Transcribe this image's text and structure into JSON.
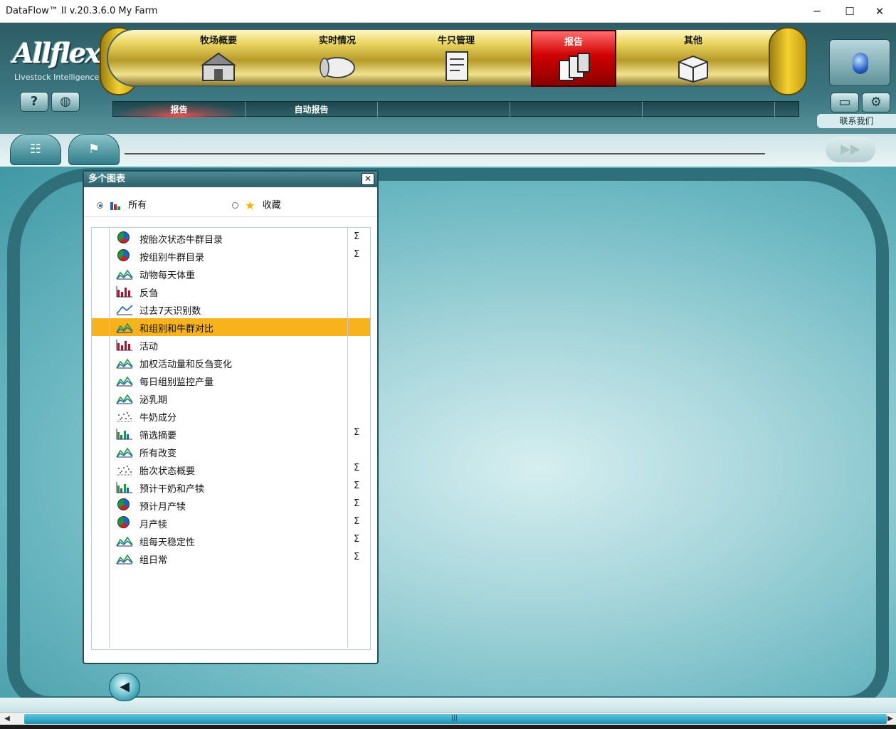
{
  "window": {
    "title": "DataFlow™ II v.20.3.6.0 My Farm",
    "controls": [
      "─",
      "☐",
      "✕"
    ]
  },
  "brand": {
    "logo": "Allflex",
    "tagline": "Livestock Intelligence"
  },
  "header_buttons": {
    "help": "?",
    "globe": "◍"
  },
  "nav": {
    "items": [
      {
        "label": "牧场概要",
        "icon": "barn-icon"
      },
      {
        "label": "实时情况",
        "icon": "milk-tank-icon"
      },
      {
        "label": "牛只管理",
        "icon": "clipboard-icon"
      },
      {
        "label": "报告",
        "icon": "report-icon",
        "active": true
      },
      {
        "label": "其他",
        "icon": "box-icon"
      }
    ],
    "subtabs": [
      "报告",
      "自动报告",
      "",
      "",
      ""
    ]
  },
  "right_panel": {
    "contact": "联系我们"
  },
  "dialog": {
    "title": "多个图表",
    "close": "✕",
    "filter_all": "所有",
    "filter_fav": "收藏",
    "items": [
      {
        "label": "按胎次状态牛群目录",
        "icon": "pie",
        "sigma": "Σ"
      },
      {
        "label": "按组别牛群目录",
        "icon": "pie",
        "sigma": "Σ"
      },
      {
        "label": "动物每天体重",
        "icon": "area",
        "sigma": ""
      },
      {
        "label": "反刍",
        "icon": "bar",
        "sigma": ""
      },
      {
        "label": "过去7天识别数",
        "icon": "line",
        "sigma": ""
      },
      {
        "label": "和组别和牛群对比",
        "icon": "area",
        "sigma": "",
        "selected": true
      },
      {
        "label": "活动",
        "icon": "bar",
        "sigma": ""
      },
      {
        "label": "加权活动量和反刍变化",
        "icon": "area",
        "sigma": ""
      },
      {
        "label": "每日组别监控产量",
        "icon": "area",
        "sigma": ""
      },
      {
        "label": "泌乳期",
        "icon": "area",
        "sigma": ""
      },
      {
        "label": "牛奶成分",
        "icon": "scatter",
        "sigma": ""
      },
      {
        "label": "筛选摘要",
        "icon": "gbar",
        "sigma": "Σ"
      },
      {
        "label": "所有改变",
        "icon": "area",
        "sigma": ""
      },
      {
        "label": "胎次状态概要",
        "icon": "scatter",
        "sigma": "Σ"
      },
      {
        "label": "预计干奶和产犊",
        "icon": "gbar",
        "sigma": "Σ"
      },
      {
        "label": "预计月产犊",
        "icon": "pie",
        "sigma": "Σ"
      },
      {
        "label": "月产犊",
        "icon": "pie",
        "sigma": "Σ"
      },
      {
        "label": "组每天稳定性",
        "icon": "area",
        "sigma": "Σ"
      },
      {
        "label": "组日常",
        "icon": "area",
        "sigma": "Σ"
      }
    ]
  },
  "colors": {
    "selected_row": "#f7b21c",
    "active_tab": "#d00000",
    "scroll_thumb": "#1f8fb0"
  }
}
